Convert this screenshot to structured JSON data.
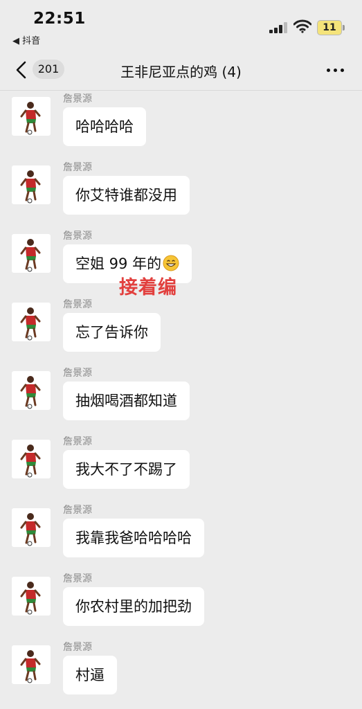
{
  "status_bar": {
    "time": "22:51",
    "back_to_app": "◀ 抖音",
    "battery": "11"
  },
  "nav": {
    "unread_count": "201",
    "title": "王非尼亚点的鸡 (4)"
  },
  "messages": [
    {
      "sender": "詹景源",
      "text": "哈哈哈哈"
    },
    {
      "sender": "詹景源",
      "text": "你艾特谁都没用"
    },
    {
      "sender": "詹景源",
      "text": "空姐 99 年的",
      "emoji": "grinning-face-icon"
    },
    {
      "sender": "詹景源",
      "text": "忘了告诉你"
    },
    {
      "sender": "詹景源",
      "text": "抽烟喝酒都知道"
    },
    {
      "sender": "詹景源",
      "text": "我大不了不踢了"
    },
    {
      "sender": "詹景源",
      "text": "我靠我爸哈哈哈哈"
    },
    {
      "sender": "詹景源",
      "text": "你农村里的加把劲"
    },
    {
      "sender": "詹景源",
      "text": "村逼"
    }
  ],
  "overlay_caption": "接着编",
  "colors": {
    "background": "#ececec",
    "bubble": "#ffffff",
    "caption": "#e2403e"
  }
}
